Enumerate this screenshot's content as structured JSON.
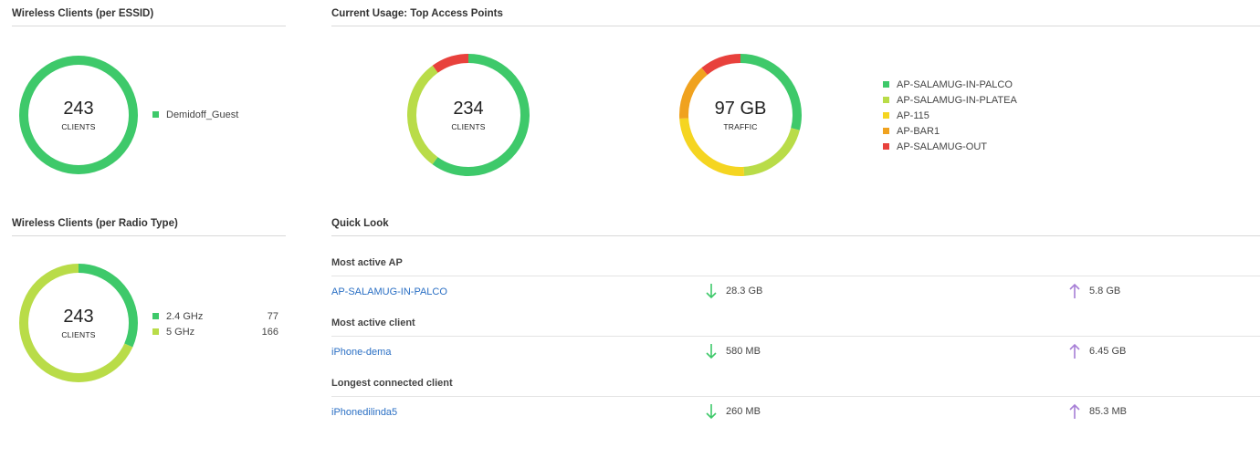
{
  "essid": {
    "title": "Wireless Clients (per ESSID)",
    "value": "243",
    "unit": "CLIENTS",
    "slices": [
      1
    ],
    "colors": [
      "#3ec96a"
    ],
    "legend": [
      {
        "label": "Demidoff_Guest",
        "color": "#3ec96a"
      }
    ]
  },
  "radio": {
    "title": "Wireless Clients (per Radio Type)",
    "value": "243",
    "unit": "CLIENTS",
    "slices": [
      77,
      166
    ],
    "colors": [
      "#3ec96a",
      "#b9dc48"
    ],
    "legend": [
      {
        "label": "2.4 GHz",
        "count": "77",
        "color": "#3ec96a"
      },
      {
        "label": "5 GHz",
        "count": "166",
        "color": "#b9dc48"
      }
    ]
  },
  "usage": {
    "title": "Current Usage: Top Access Points",
    "clients": {
      "value": "234",
      "unit": "CLIENTS",
      "slices": [
        0.6,
        0.3,
        0.1
      ],
      "colors": [
        "#3ec96a",
        "#b9dc48",
        "#e8413c"
      ]
    },
    "traffic": {
      "value": "97 GB",
      "unit": "TRAFFIC",
      "slices": [
        0.29,
        0.2,
        0.25,
        0.15,
        0.11
      ],
      "colors": [
        "#3ec96a",
        "#b9dc48",
        "#f5d521",
        "#f0a21f",
        "#e8413c"
      ]
    },
    "legend": [
      {
        "label": "AP-SALAMUG-IN-PALCO",
        "color": "#3ec96a"
      },
      {
        "label": "AP-SALAMUG-IN-PLATEA",
        "color": "#b9dc48"
      },
      {
        "label": "AP-115",
        "color": "#f5d521"
      },
      {
        "label": "AP-BAR1",
        "color": "#f0a21f"
      },
      {
        "label": "AP-SALAMUG-OUT",
        "color": "#e8413c"
      }
    ]
  },
  "quick_look": {
    "title": "Quick Look",
    "sections": [
      {
        "heading": "Most active AP",
        "name": "AP-SALAMUG-IN-PALCO",
        "down": "28.3 GB",
        "up": "5.8 GB"
      },
      {
        "heading": "Most active client",
        "name": "iPhone-dema",
        "down": "580 MB",
        "up": "6.45 GB"
      },
      {
        "heading": "Longest connected client",
        "name": "iPhonedilinda5",
        "down": "260 MB",
        "up": "85.3 MB"
      }
    ]
  },
  "colors": {
    "link": "#2a6fc4",
    "down_arrow": "#3ec96a",
    "up_arrow": "#a77fd6"
  }
}
